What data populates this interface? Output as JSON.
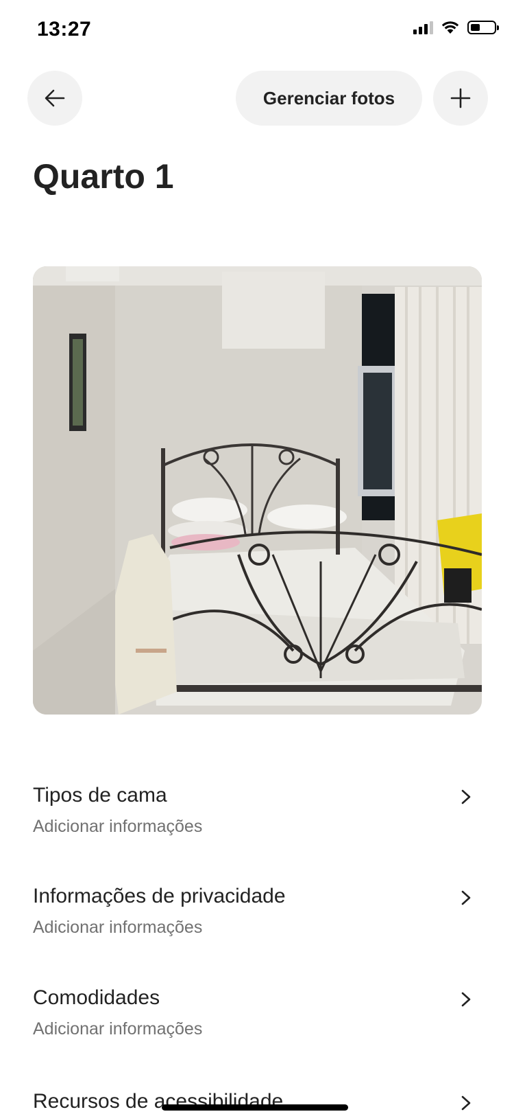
{
  "status_bar": {
    "time": "13:27",
    "signal_icon": "cellular-signal-icon",
    "wifi_icon": "wifi-icon",
    "battery_icon": "battery-icon",
    "battery_level": 0.4
  },
  "header": {
    "back_icon": "arrow-left-icon",
    "manage_photos_label": "Gerenciar fotos",
    "add_icon": "plus-icon"
  },
  "page": {
    "title": "Quarto 1"
  },
  "photo": {
    "alt": "Quarto com cama de ferro"
  },
  "details": [
    {
      "title": "Tipos de cama",
      "subtitle": "Adicionar informações"
    },
    {
      "title": "Informações de privacidade",
      "subtitle": "Adicionar informações"
    },
    {
      "title": "Comodidades",
      "subtitle": "Adicionar informações"
    },
    {
      "title": "Recursos de acessibilidade",
      "subtitle": ""
    }
  ],
  "colors": {
    "text_primary": "#222222",
    "text_secondary": "#717171",
    "button_bg": "#f2f2f2"
  }
}
